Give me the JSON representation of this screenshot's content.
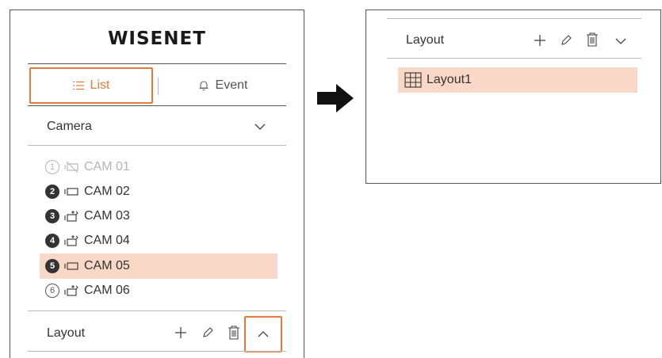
{
  "brand": {
    "logo_text": "WISENET"
  },
  "tabs": [
    {
      "label": "List",
      "icon": "list-icon",
      "active": true
    },
    {
      "label": "Event",
      "icon": "bell-icon",
      "active": false
    }
  ],
  "camera_section": {
    "title": "Camera",
    "items": [
      {
        "number": "1",
        "label": "CAM 01",
        "state": "disabled",
        "icon": "camera-disabled-icon"
      },
      {
        "number": "2",
        "label": "CAM 02",
        "state": "normal",
        "icon": "camera-icon"
      },
      {
        "number": "3",
        "label": "CAM 03",
        "state": "normal",
        "icon": "ptz-camera-icon"
      },
      {
        "number": "4",
        "label": "CAM 04",
        "state": "normal",
        "icon": "ptz-camera-icon"
      },
      {
        "number": "5",
        "label": "CAM 05",
        "state": "selected",
        "icon": "camera-icon"
      },
      {
        "number": "6",
        "label": "CAM 06",
        "state": "normal",
        "icon": "ptz-camera-icon"
      }
    ]
  },
  "layout_section": {
    "title": "Layout",
    "actions": [
      "add-icon",
      "edit-icon",
      "delete-icon"
    ],
    "toggle_state": "expanded"
  },
  "layout_panel": {
    "title": "Layout",
    "actions": [
      "add-icon",
      "edit-icon",
      "delete-icon",
      "chevron-down-icon"
    ],
    "items": [
      {
        "label": "Layout1",
        "icon": "grid-layout-icon",
        "selected": true
      }
    ]
  },
  "colors": {
    "accent": "#e57a3b",
    "selection": "#f9d8c8",
    "text": "#333333",
    "disabled": "#b5b5b5"
  }
}
